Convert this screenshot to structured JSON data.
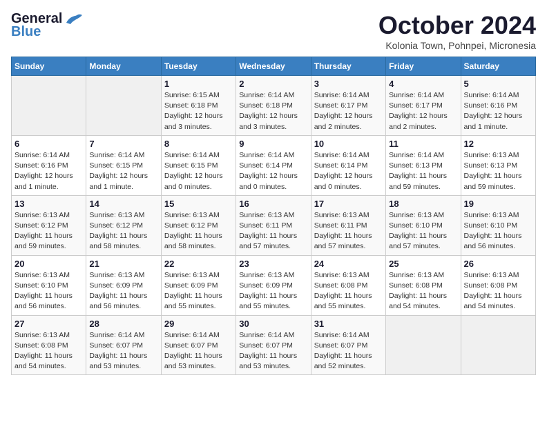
{
  "logo": {
    "line1": "General",
    "line2": "Blue"
  },
  "title": "October 2024",
  "location": "Kolonia Town, Pohnpei, Micronesia",
  "headers": [
    "Sunday",
    "Monday",
    "Tuesday",
    "Wednesday",
    "Thursday",
    "Friday",
    "Saturday"
  ],
  "weeks": [
    [
      {
        "num": "",
        "info": ""
      },
      {
        "num": "",
        "info": ""
      },
      {
        "num": "1",
        "info": "Sunrise: 6:15 AM\nSunset: 6:18 PM\nDaylight: 12 hours and 3 minutes."
      },
      {
        "num": "2",
        "info": "Sunrise: 6:14 AM\nSunset: 6:18 PM\nDaylight: 12 hours and 3 minutes."
      },
      {
        "num": "3",
        "info": "Sunrise: 6:14 AM\nSunset: 6:17 PM\nDaylight: 12 hours and 2 minutes."
      },
      {
        "num": "4",
        "info": "Sunrise: 6:14 AM\nSunset: 6:17 PM\nDaylight: 12 hours and 2 minutes."
      },
      {
        "num": "5",
        "info": "Sunrise: 6:14 AM\nSunset: 6:16 PM\nDaylight: 12 hours and 1 minute."
      }
    ],
    [
      {
        "num": "6",
        "info": "Sunrise: 6:14 AM\nSunset: 6:16 PM\nDaylight: 12 hours and 1 minute."
      },
      {
        "num": "7",
        "info": "Sunrise: 6:14 AM\nSunset: 6:15 PM\nDaylight: 12 hours and 1 minute."
      },
      {
        "num": "8",
        "info": "Sunrise: 6:14 AM\nSunset: 6:15 PM\nDaylight: 12 hours and 0 minutes."
      },
      {
        "num": "9",
        "info": "Sunrise: 6:14 AM\nSunset: 6:14 PM\nDaylight: 12 hours and 0 minutes."
      },
      {
        "num": "10",
        "info": "Sunrise: 6:14 AM\nSunset: 6:14 PM\nDaylight: 12 hours and 0 minutes."
      },
      {
        "num": "11",
        "info": "Sunrise: 6:14 AM\nSunset: 6:13 PM\nDaylight: 11 hours and 59 minutes."
      },
      {
        "num": "12",
        "info": "Sunrise: 6:13 AM\nSunset: 6:13 PM\nDaylight: 11 hours and 59 minutes."
      }
    ],
    [
      {
        "num": "13",
        "info": "Sunrise: 6:13 AM\nSunset: 6:12 PM\nDaylight: 11 hours and 59 minutes."
      },
      {
        "num": "14",
        "info": "Sunrise: 6:13 AM\nSunset: 6:12 PM\nDaylight: 11 hours and 58 minutes."
      },
      {
        "num": "15",
        "info": "Sunrise: 6:13 AM\nSunset: 6:12 PM\nDaylight: 11 hours and 58 minutes."
      },
      {
        "num": "16",
        "info": "Sunrise: 6:13 AM\nSunset: 6:11 PM\nDaylight: 11 hours and 57 minutes."
      },
      {
        "num": "17",
        "info": "Sunrise: 6:13 AM\nSunset: 6:11 PM\nDaylight: 11 hours and 57 minutes."
      },
      {
        "num": "18",
        "info": "Sunrise: 6:13 AM\nSunset: 6:10 PM\nDaylight: 11 hours and 57 minutes."
      },
      {
        "num": "19",
        "info": "Sunrise: 6:13 AM\nSunset: 6:10 PM\nDaylight: 11 hours and 56 minutes."
      }
    ],
    [
      {
        "num": "20",
        "info": "Sunrise: 6:13 AM\nSunset: 6:10 PM\nDaylight: 11 hours and 56 minutes."
      },
      {
        "num": "21",
        "info": "Sunrise: 6:13 AM\nSunset: 6:09 PM\nDaylight: 11 hours and 56 minutes."
      },
      {
        "num": "22",
        "info": "Sunrise: 6:13 AM\nSunset: 6:09 PM\nDaylight: 11 hours and 55 minutes."
      },
      {
        "num": "23",
        "info": "Sunrise: 6:13 AM\nSunset: 6:09 PM\nDaylight: 11 hours and 55 minutes."
      },
      {
        "num": "24",
        "info": "Sunrise: 6:13 AM\nSunset: 6:08 PM\nDaylight: 11 hours and 55 minutes."
      },
      {
        "num": "25",
        "info": "Sunrise: 6:13 AM\nSunset: 6:08 PM\nDaylight: 11 hours and 54 minutes."
      },
      {
        "num": "26",
        "info": "Sunrise: 6:13 AM\nSunset: 6:08 PM\nDaylight: 11 hours and 54 minutes."
      }
    ],
    [
      {
        "num": "27",
        "info": "Sunrise: 6:13 AM\nSunset: 6:08 PM\nDaylight: 11 hours and 54 minutes."
      },
      {
        "num": "28",
        "info": "Sunrise: 6:14 AM\nSunset: 6:07 PM\nDaylight: 11 hours and 53 minutes."
      },
      {
        "num": "29",
        "info": "Sunrise: 6:14 AM\nSunset: 6:07 PM\nDaylight: 11 hours and 53 minutes."
      },
      {
        "num": "30",
        "info": "Sunrise: 6:14 AM\nSunset: 6:07 PM\nDaylight: 11 hours and 53 minutes."
      },
      {
        "num": "31",
        "info": "Sunrise: 6:14 AM\nSunset: 6:07 PM\nDaylight: 11 hours and 52 minutes."
      },
      {
        "num": "",
        "info": ""
      },
      {
        "num": "",
        "info": ""
      }
    ]
  ]
}
